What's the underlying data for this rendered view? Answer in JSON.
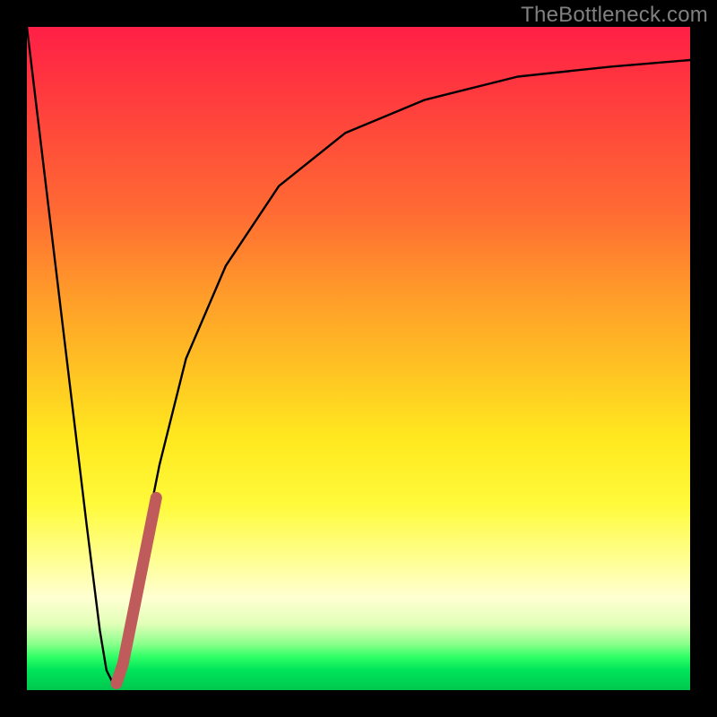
{
  "watermark": "TheBottleneck.com",
  "chart_data": {
    "type": "line",
    "title": "",
    "xlabel": "",
    "ylabel": "",
    "xlim": [
      0,
      100
    ],
    "ylim": [
      0,
      100
    ],
    "series": [
      {
        "name": "main-curve",
        "color": "#000000",
        "x": [
          0,
          3,
          6,
          9,
          11,
          12,
          13,
          14,
          16,
          18,
          20,
          24,
          30,
          38,
          48,
          60,
          74,
          88,
          100
        ],
        "values": [
          100,
          75,
          50,
          25,
          9,
          3,
          1,
          3,
          12,
          24,
          34,
          50,
          64,
          76,
          84,
          89,
          92.5,
          94,
          95
        ]
      },
      {
        "name": "highlight-segment",
        "color": "#c05b5b",
        "x": [
          13.5,
          14.5,
          15.5,
          16.5,
          17.5,
          18.5,
          19.5
        ],
        "values": [
          1,
          4,
          9,
          14,
          19,
          24,
          29
        ]
      }
    ]
  }
}
